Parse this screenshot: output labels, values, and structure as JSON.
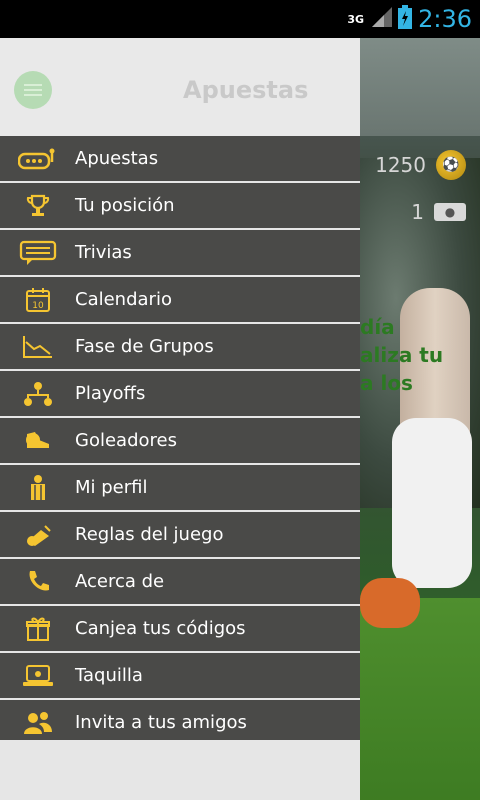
{
  "status": {
    "network": "3G",
    "time": "2:36"
  },
  "app": {
    "title": "Apuestas",
    "coins": "1250",
    "tickets": "1",
    "promo_text": "día\naliza tu\na los"
  },
  "drawer": {
    "title": "Apuestas",
    "items": [
      {
        "label": "Apuestas",
        "icon": "slot-machine-icon"
      },
      {
        "label": "Tu posición",
        "icon": "trophy-icon"
      },
      {
        "label": "Trivias",
        "icon": "chat-icon"
      },
      {
        "label": "Calendario",
        "icon": "calendar-icon"
      },
      {
        "label": "Fase de Grupos",
        "icon": "trend-chart-icon"
      },
      {
        "label": "Playoffs",
        "icon": "bracket-icon"
      },
      {
        "label": "Goleadores",
        "icon": "soccer-boot-icon"
      },
      {
        "label": "Mi perfil",
        "icon": "player-icon"
      },
      {
        "label": "Reglas del juego",
        "icon": "whistle-icon"
      },
      {
        "label": "Acerca de",
        "icon": "phone-icon"
      },
      {
        "label": "Canjea tus códigos",
        "icon": "gift-icon"
      },
      {
        "label": "Taquilla",
        "icon": "laptop-icon"
      },
      {
        "label": "Invita a tus amigos",
        "icon": "friends-icon"
      }
    ]
  },
  "colors": {
    "accent": "#f5c531",
    "menu_bg": "#4a4a48",
    "drawer_bg": "#e6e6e6"
  }
}
